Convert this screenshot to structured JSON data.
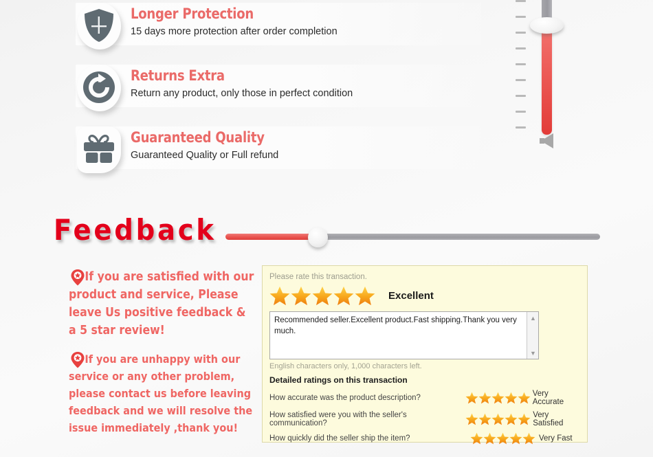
{
  "features": [
    {
      "icon": "shield-icon",
      "title": "Longer Protection",
      "desc": "15 days more protection after order completion"
    },
    {
      "icon": "returns-refresh-icon",
      "title": "Returns Extra",
      "desc": "Return any product, only those in perfect condition"
    },
    {
      "icon": "gift-box-icon",
      "title": "Guaranteed Quality",
      "desc": "Guaranteed Quality or Full refund"
    }
  ],
  "vertical_slider": {
    "icon": "speaker-icon",
    "tick_count": 9,
    "fill_color": "#e8504c",
    "track_color": "#9a9aa0"
  },
  "horizontal_slider": {
    "fill_color": "#e8504c",
    "track_color": "#9b9ba0",
    "value_percent": 25
  },
  "feedback": {
    "title": "Feedback",
    "title_color": "#e3001b",
    "notes": [
      {
        "icon": "map-pin-star-icon",
        "text": "If you are satisfied with our product and service, Please leave Us positive feedback & a 5 star review!"
      },
      {
        "icon": "map-pin-star-icon",
        "text": "If you are unhappy with our service or any other problem, please contact us before leaving feedback and we will resolve the issue immediately ,thank you!"
      }
    ]
  },
  "rating_panel": {
    "prompt": "Please rate this transaction.",
    "overall_stars": 5,
    "overall_label": "Excellent",
    "comment": "Recommended seller.Excellent product.Fast shipping.Thank you very much.",
    "char_note": "English characters only, 1,000 characters left.",
    "detailed_heading": "Detailed ratings on this transaction",
    "detailed_rows": [
      {
        "question": "How accurate was the product description?",
        "stars": 5,
        "label": "Very Accurate"
      },
      {
        "question": "How satisfied were you with the seller's communication?",
        "stars": 5,
        "label": "Very Satisfied"
      },
      {
        "question": "How quickly did the seller ship the item?",
        "stars": 5,
        "label": "Very Fast"
      }
    ],
    "scrollbar_up_icon": "chevron-up-icon",
    "scrollbar_down_icon": "chevron-down-icon",
    "panel_color": "#fdfbdd",
    "star_color": "#f5a623"
  }
}
